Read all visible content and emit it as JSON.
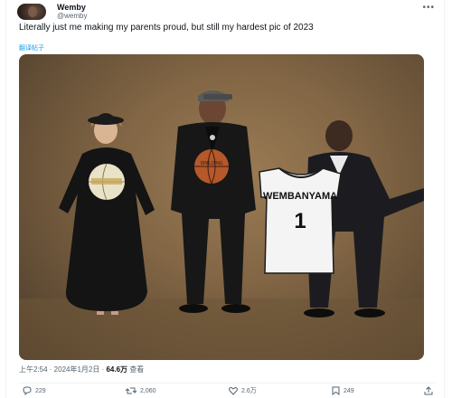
{
  "author": {
    "name": "Wemby",
    "handle": "@wemby"
  },
  "tweet": {
    "text": "Literally just me making my parents proud, but still my hardest pic of 2023",
    "translate_label": "翻译帖子"
  },
  "photo": {
    "jersey_name": "WEMBANYAMA",
    "jersey_number": "1",
    "basketball_text": "SPALDING"
  },
  "meta": {
    "timestamp": "上午2:54 · 2024年1月2日 · ",
    "views_count": "64.6万",
    "views_label": " 查看"
  },
  "actions": {
    "replies": "229",
    "reposts": "2,060",
    "likes": "2.6万",
    "bookmarks": "249"
  },
  "colors": {
    "text": "#0f1419",
    "muted": "#536471",
    "link": "#1d9bf0"
  },
  "icons": [
    "more-icon",
    "reply-icon",
    "repost-icon",
    "like-icon",
    "bookmark-icon",
    "share-icon"
  ]
}
